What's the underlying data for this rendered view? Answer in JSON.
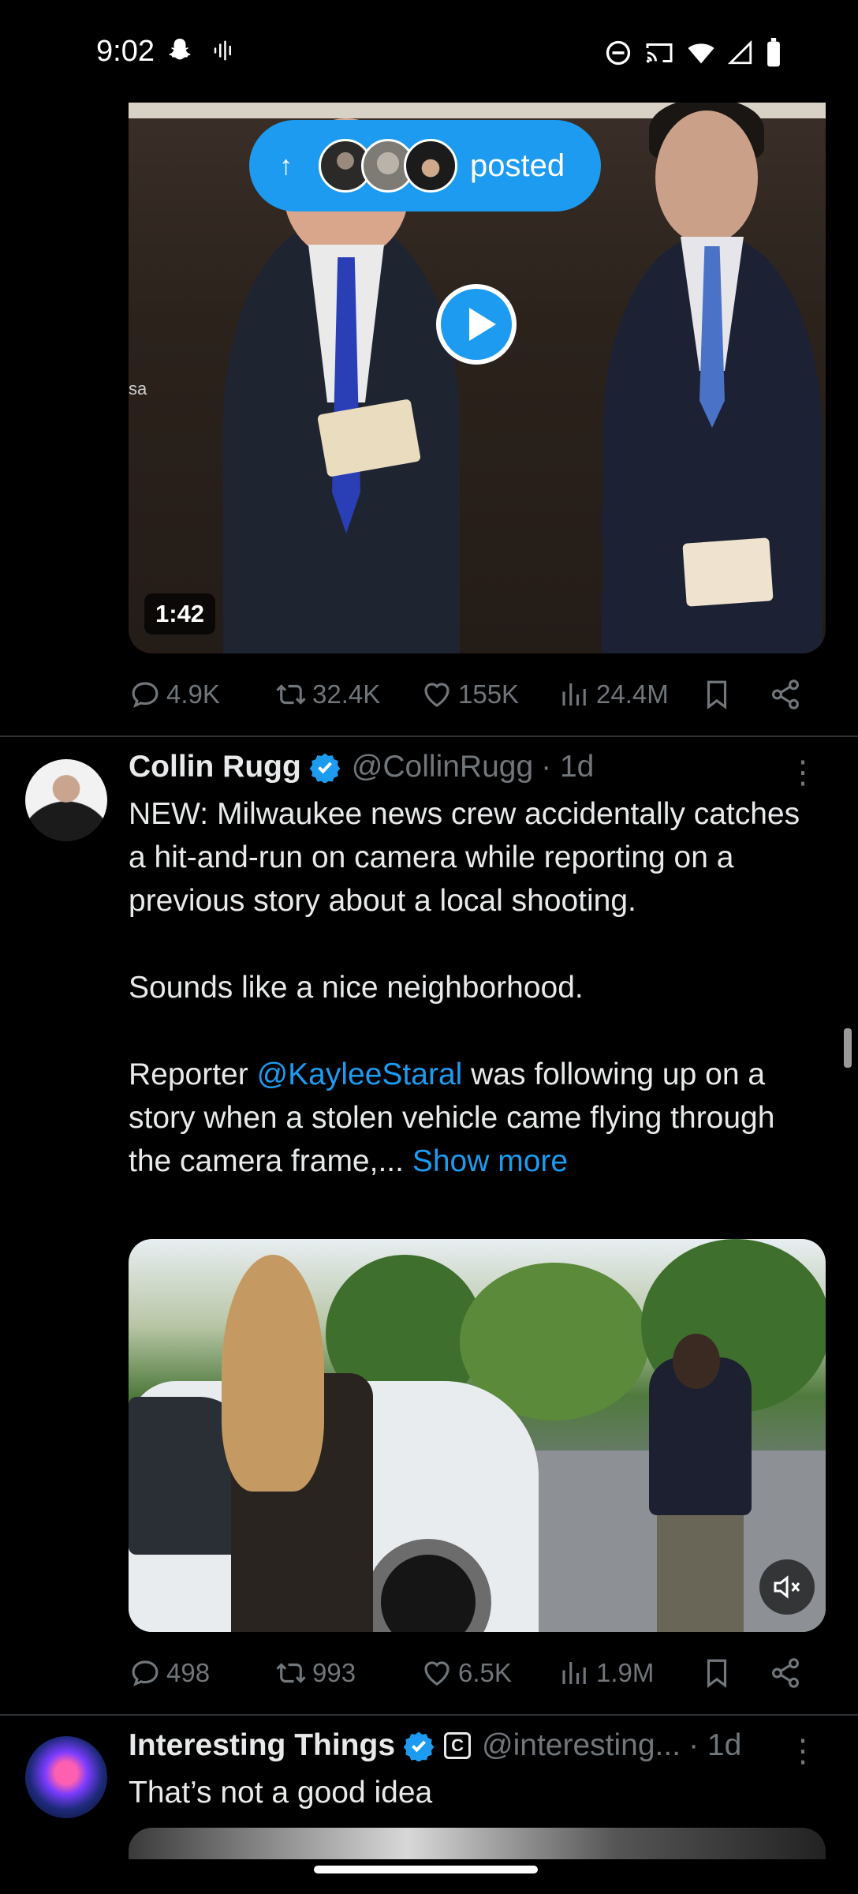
{
  "status_bar": {
    "time": "9:02"
  },
  "feed_notice": {
    "posted_label": "posted"
  },
  "tweet1": {
    "video_duration": "1:42",
    "video_edge_text": "sa",
    "replies": "4.9K",
    "reposts": "32.4K",
    "likes": "155K",
    "views": "24.4M"
  },
  "tweet2": {
    "name": "Collin Rugg",
    "handle": "@CollinRugg",
    "time": "· 1d",
    "paragraph1": "NEW: Milwaukee news crew accidentally catches a hit-and-run on camera while reporting on a previous story about a local shooting.",
    "paragraph2": "Sounds like a nice neighborhood.",
    "paragraph3_prefix": "Reporter ",
    "mention": "@KayleeStaral",
    "paragraph3_suffix": " was following up on a story when a stolen vehicle came flying through the camera frame,...",
    "show_more": "Show more",
    "replies": "498",
    "reposts": "993",
    "likes": "6.5K",
    "views": "1.9M"
  },
  "tweet3": {
    "name": "Interesting Things",
    "handle": "@interesting...",
    "time": "· 1d",
    "text": "That’s not a good idea"
  },
  "colors": {
    "accent": "#1d9bf0",
    "muted": "#71767b",
    "text": "#e7e9ea",
    "background": "#000000"
  }
}
